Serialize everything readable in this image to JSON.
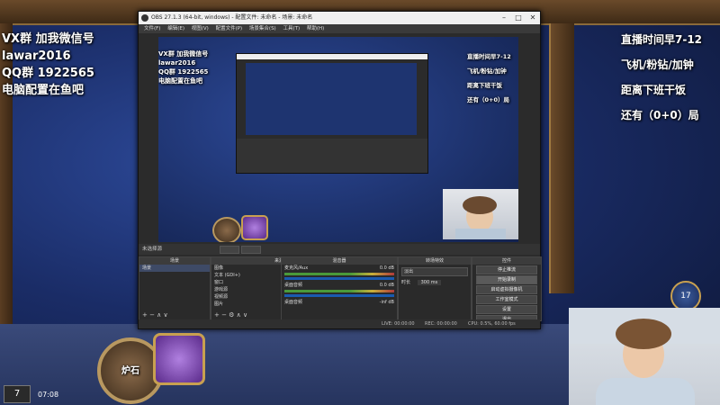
{
  "overlay_left": {
    "line1": "VX群 加我微信号",
    "line2": "lawar2016",
    "line3": "QQ群 1922565",
    "line4": "电脑配置在鱼吧"
  },
  "overlay_right": {
    "line1": "直播时间早7-12",
    "line2": "飞机/粉钻/加钟",
    "line3": "距离下班干饭",
    "line4": "还有（0+0）局"
  },
  "obs": {
    "title": "OBS 27.1.3 (64-bit, windows) - 配置文件: 未命名 - 场景: 未命名",
    "menu": [
      "文件(F)",
      "编辑(E)",
      "视图(V)",
      "配置文件(P)",
      "场景集合(S)",
      "工具(T)",
      "帮助(H)"
    ],
    "scenebar": "未选择源",
    "docks": {
      "scenes": {
        "title": "场景",
        "items": [
          "场景"
        ]
      },
      "sources": {
        "title": "来源",
        "items": [
          "图像",
          "文本 (GDI+)",
          "窗口",
          "游戏源",
          "视频源",
          "图片"
        ]
      },
      "mixer": {
        "title": "混音器",
        "items": [
          "麦克风/Aux",
          "桌面音频",
          "桌面音频"
        ],
        "levels": [
          "0.0 dB",
          "0.0 dB",
          "-inf dB"
        ]
      },
      "transitions": {
        "title": "转场特效",
        "type": "淡出",
        "duration_label": "时长",
        "duration": "300 ms"
      },
      "controls": {
        "title": "控件",
        "buttons": [
          "停止推流",
          "开始录制",
          "启动虚拟摄像机",
          "工作室模式",
          "设置",
          "退出"
        ]
      }
    },
    "status": {
      "live": "LIVE: 00:00:00",
      "rec": "REC: 00:00:00",
      "cpu": "CPU: 0.5%, 60.00 fps"
    }
  },
  "game": {
    "hero_label": "炉石",
    "power_cost": "17",
    "deck_count": "7",
    "clock": "07:08"
  }
}
